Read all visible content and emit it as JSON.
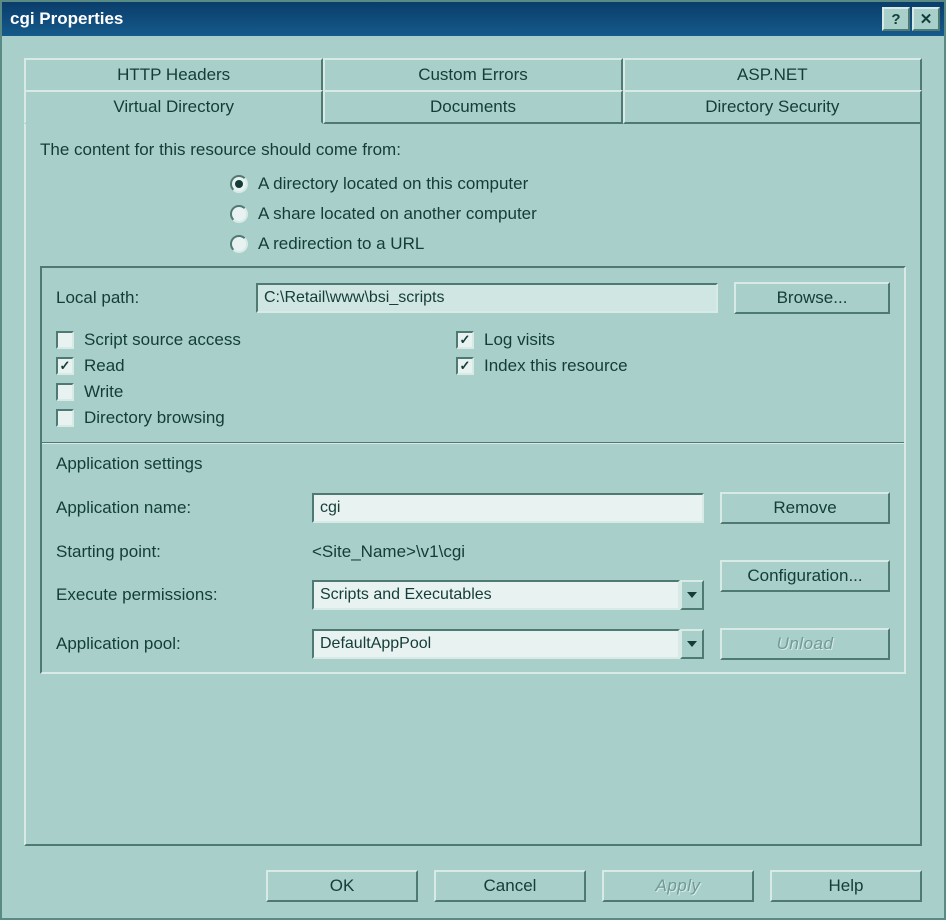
{
  "window": {
    "title": "cgi Properties"
  },
  "tabs_top": [
    "HTTP Headers",
    "Custom Errors",
    "ASP.NET"
  ],
  "tabs_bot": [
    "Virtual Directory",
    "Documents",
    "Directory Security"
  ],
  "active_tab": "Virtual Directory",
  "prompt": "The content for this resource should come from:",
  "radios": [
    {
      "label": "A directory located on this computer",
      "selected": true
    },
    {
      "label": "A share located on another computer",
      "selected": false
    },
    {
      "label": "A redirection to a URL",
      "selected": false
    }
  ],
  "path": {
    "label": "Local path:",
    "value": "C:\\Retail\\www\\bsi_scripts",
    "browse": "Browse..."
  },
  "checks_left": [
    {
      "label": "Script source access",
      "checked": false
    },
    {
      "label": "Read",
      "checked": true
    },
    {
      "label": "Write",
      "checked": false
    },
    {
      "label": "Directory browsing",
      "checked": false
    }
  ],
  "checks_right": [
    {
      "label": "Log visits",
      "checked": true
    },
    {
      "label": "Index this resource",
      "checked": true
    }
  ],
  "app": {
    "heading": "Application settings",
    "name_label": "Application name:",
    "name_value": "cgi",
    "remove": "Remove",
    "start_label": "Starting point:",
    "start_value": "<Site_Name>\\v1\\cgi",
    "config": "Configuration...",
    "exec_label": "Execute permissions:",
    "exec_value": "Scripts and Executables",
    "pool_label": "Application pool:",
    "pool_value": "DefaultAppPool",
    "unload": "Unload"
  },
  "footer": {
    "ok": "OK",
    "cancel": "Cancel",
    "apply": "Apply",
    "help": "Help"
  }
}
